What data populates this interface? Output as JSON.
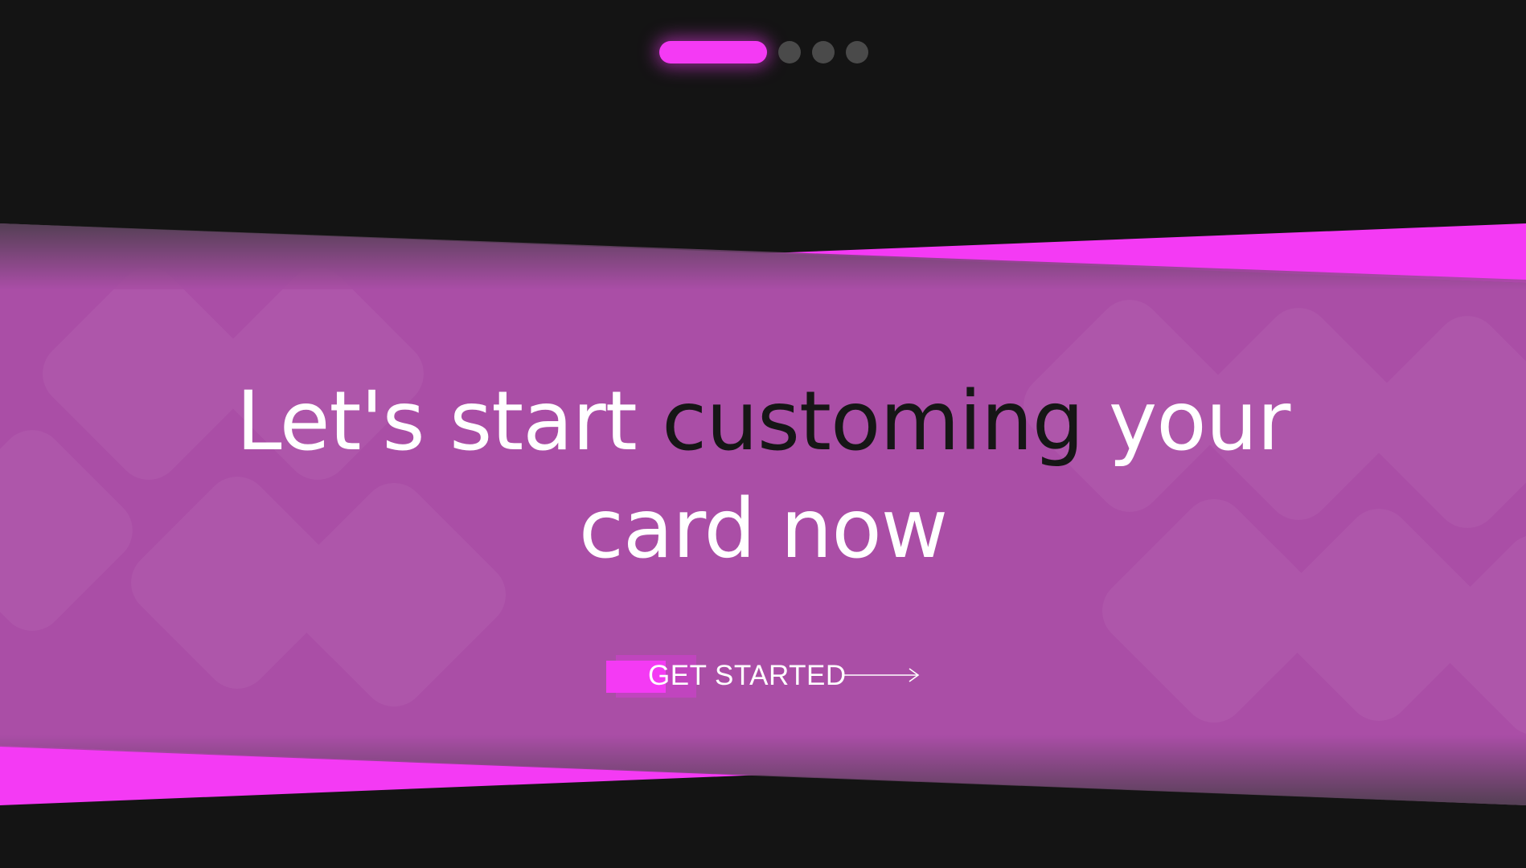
{
  "carousel": {
    "slide_count": 4,
    "active_index": 0,
    "slides": [
      "slide-1",
      "slide-2",
      "slide-3",
      "slide-4"
    ]
  },
  "hero": {
    "headline_part1": "Let's start ",
    "headline_accent": "customing",
    "headline_part2": " your",
    "headline_line2": "card now"
  },
  "cta": {
    "label": "GET STARTED",
    "icon": "arrow-right-icon"
  },
  "colors": {
    "background": "#141414",
    "accent": "#f43af4",
    "band": "#aa4ea6",
    "inactive_dot": "#4a4a4a"
  }
}
